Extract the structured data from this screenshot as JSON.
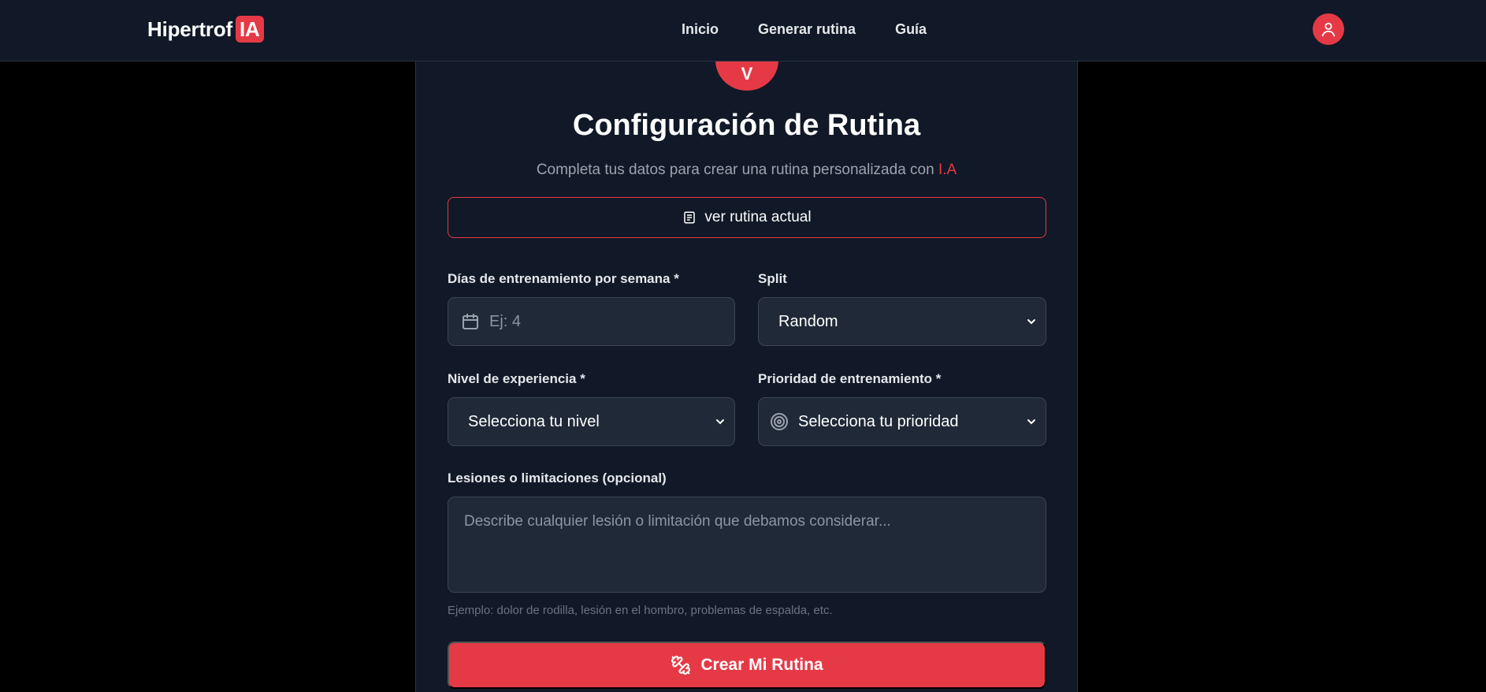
{
  "brand": {
    "name": "Hipertrof",
    "suffix": "IA"
  },
  "nav": {
    "links": [
      "Inicio",
      "Generar rutina",
      "Guía"
    ]
  },
  "header": {
    "badge_glyph": "V",
    "title": "Configuración de Rutina",
    "subtitle": "Completa tus datos para crear una rutina personalizada con ",
    "subtitle_accent": "I.A"
  },
  "view_button": {
    "label": "ver rutina actual",
    "icon": "list-icon"
  },
  "form": {
    "days": {
      "label": "Días de entrenamiento por semana *",
      "placeholder": "Ej: 4",
      "icon": "calendar-icon"
    },
    "split": {
      "label": "Split",
      "value": "Random"
    },
    "level": {
      "label": "Nivel de experiencia *",
      "value": "Selecciona tu nivel"
    },
    "priority": {
      "label": "Prioridad de entrenamiento *",
      "value": "Selecciona tu prioridad",
      "icon": "target-icon"
    },
    "injuries": {
      "label": "Lesiones o limitaciones (opcional)",
      "placeholder": "Describe cualquier lesión o limitación que debamos considerar...",
      "hint": "Ejemplo: dolor de rodilla, lesión en el hombro, problemas de espalda, etc."
    }
  },
  "submit": {
    "label": "Crear Mi Rutina",
    "icon": "dumbbell-icon"
  },
  "colors": {
    "accent": "#e63946",
    "background": "#000000",
    "surface": "#111827",
    "input": "#1f2937"
  }
}
